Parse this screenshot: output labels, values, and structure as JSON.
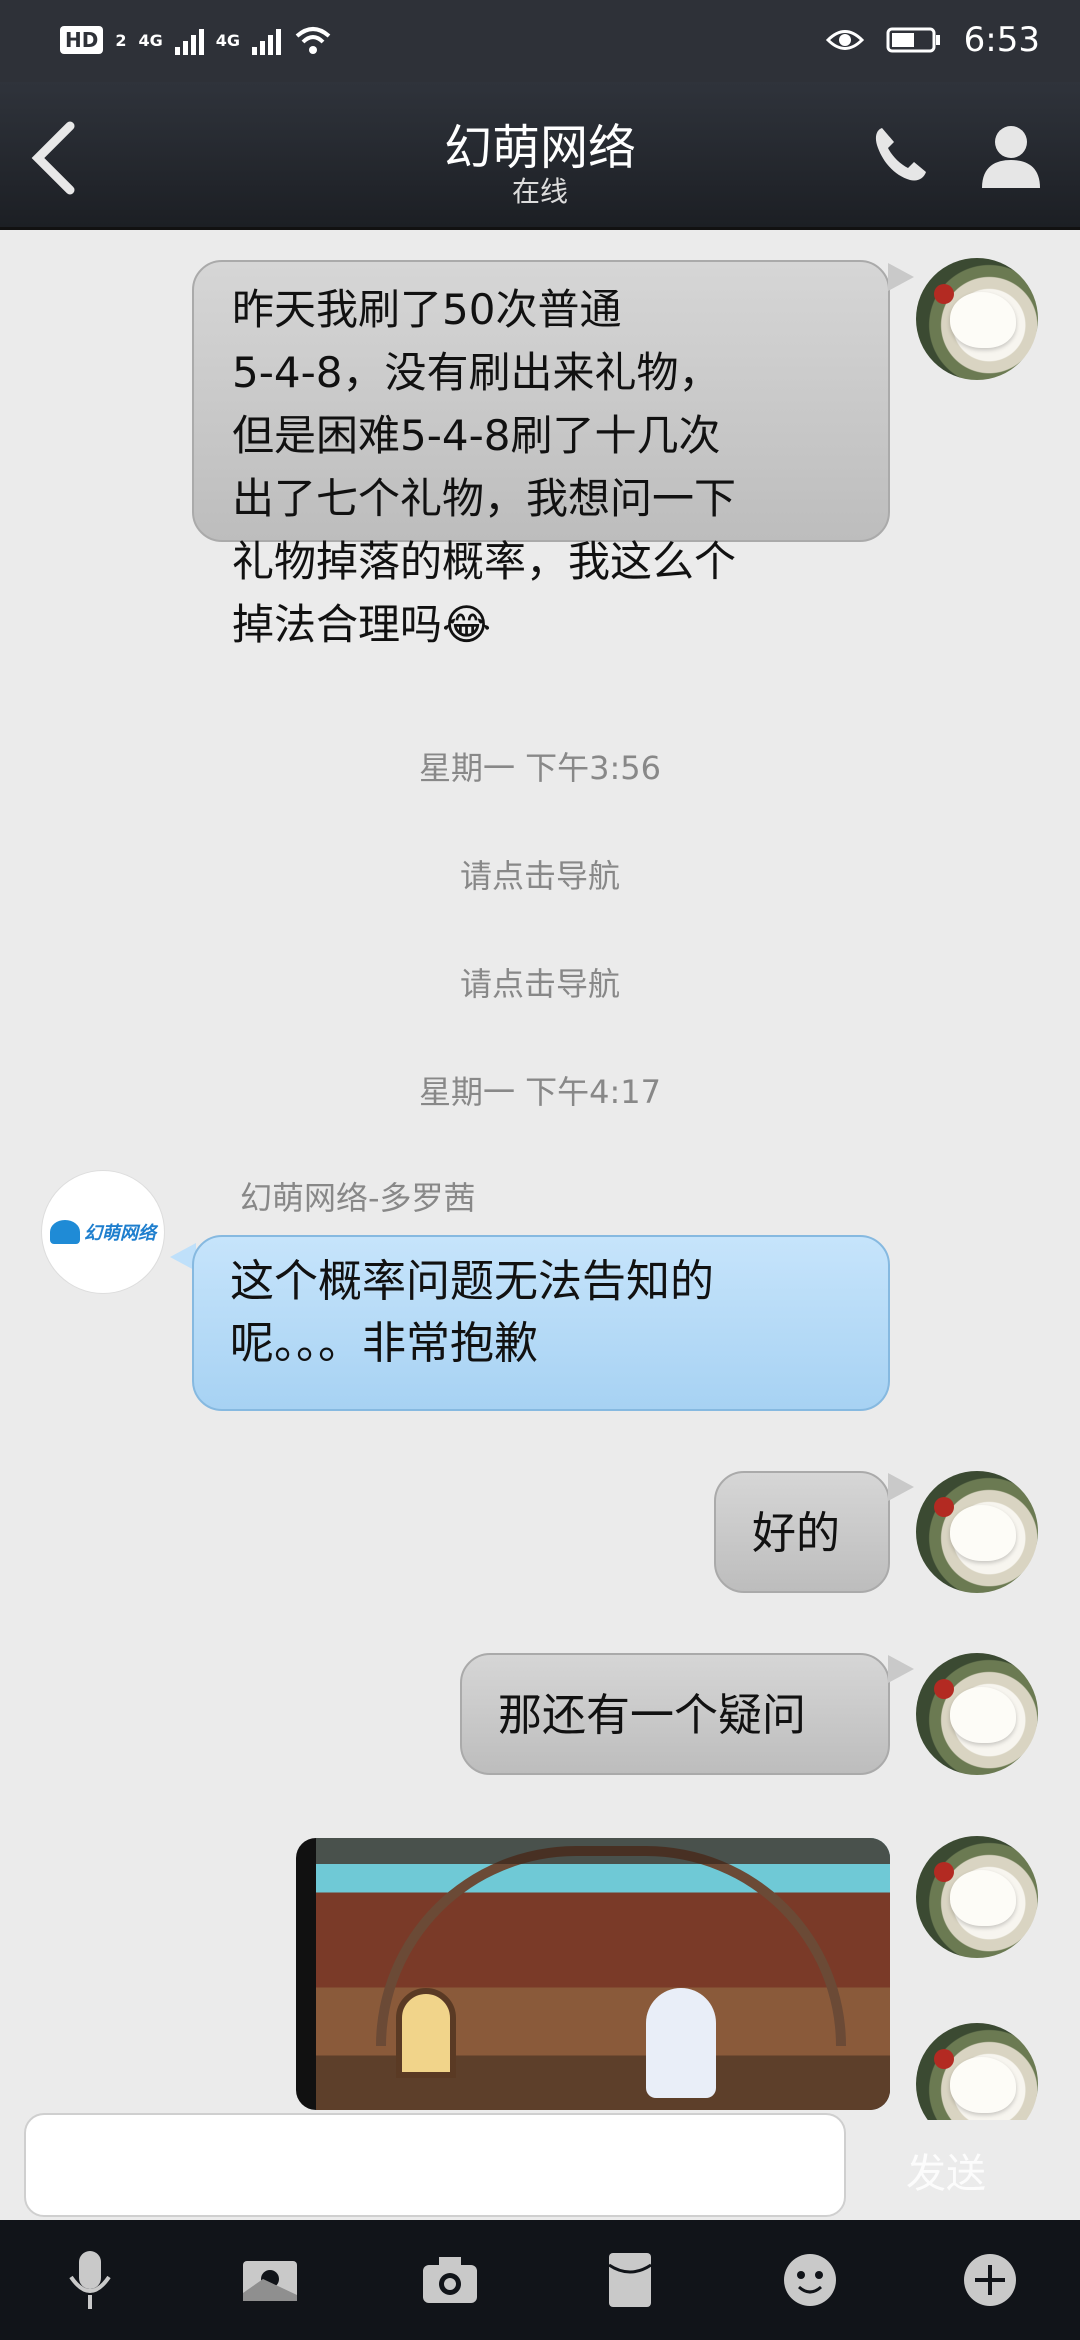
{
  "status_bar": {
    "hd": "HD",
    "sim": "2",
    "network_1": "4G",
    "network_2": "4G",
    "time": "6:53"
  },
  "header": {
    "title": "幻萌网络",
    "status": "在线"
  },
  "messages": {
    "m1": {
      "lines": [
        "昨天我刷了50次普通",
        "5-4-8，没有刷出来礼物，",
        "但是困难5-4-8刷了十几次",
        "出了七个礼物，我想问一下",
        "礼物掉落的概率，我这么个",
        "掉法合理吗😂"
      ]
    },
    "t1": "星期一 下午3:56",
    "nav1": "请点击导航",
    "nav2": "请点击导航",
    "t2": "星期一 下午4:17",
    "sender": "幻萌网络-多罗茜",
    "logo_text": "幻萌网络",
    "m2": {
      "lines": [
        "这个概率问题无法告知的",
        "呢。。。非常抱歉"
      ]
    },
    "m3": "好的",
    "m4": "那还有一个疑问"
  },
  "input": {
    "send_label": "发送"
  },
  "colors": {
    "bubble_me": "#c9c9c9",
    "bubble_them": "#bfe0fa",
    "header_bg": "#2e3138",
    "toolbar_bg": "#111419"
  }
}
